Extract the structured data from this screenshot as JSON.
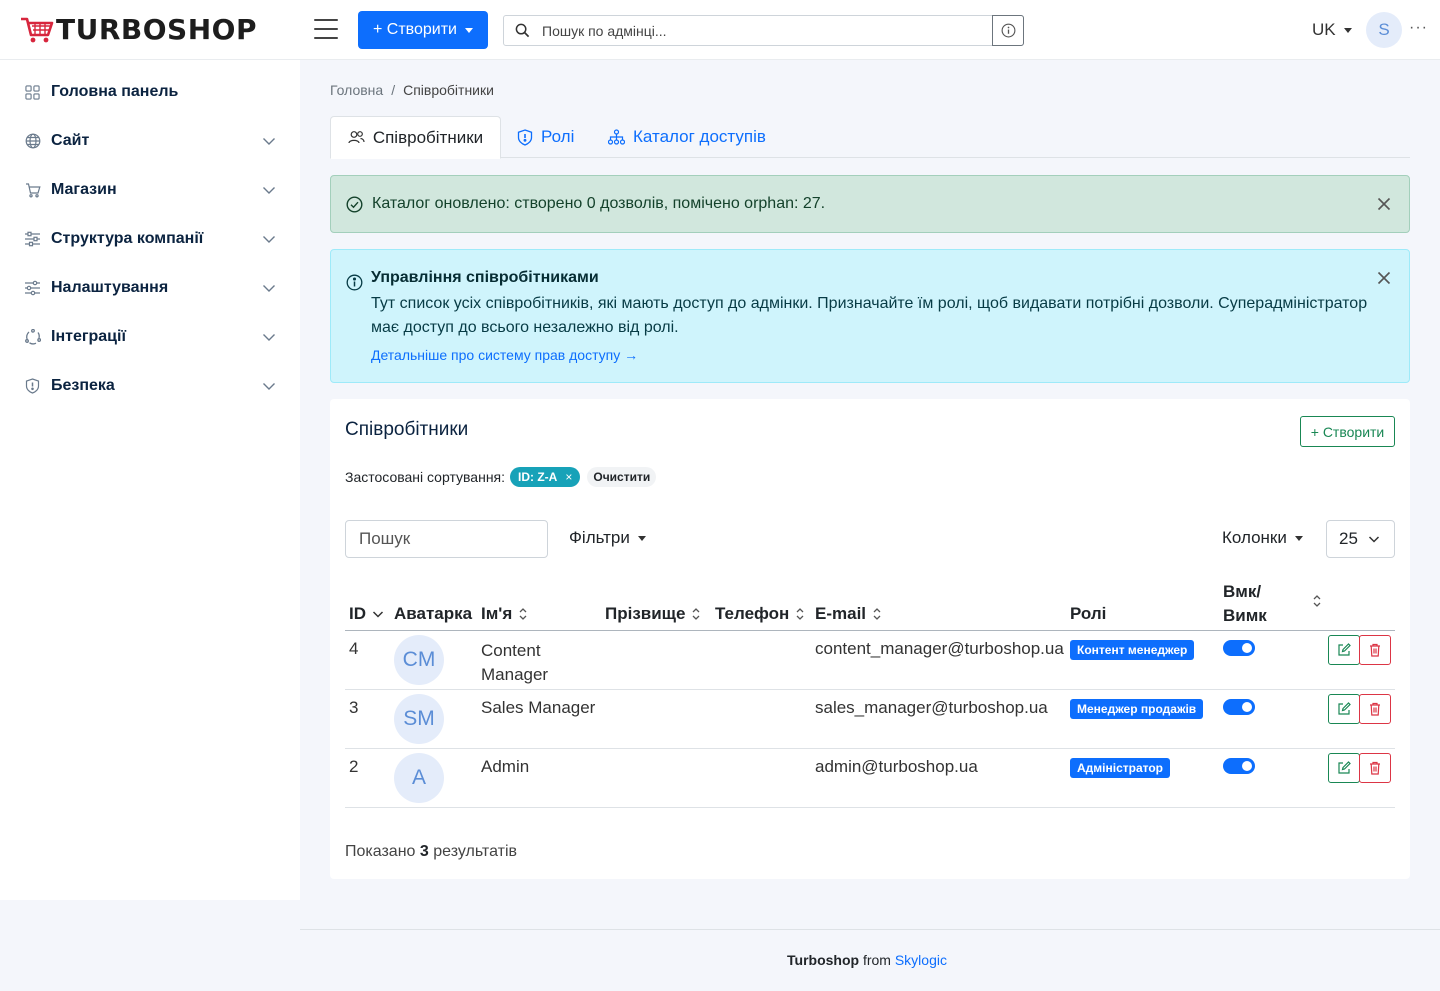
{
  "header": {
    "logo_text": "TURBOSHOP",
    "create_label": "+ Створити",
    "search_placeholder": "Пошук по адмінці...",
    "lang": "UK",
    "user_initial": "S",
    "more": "···"
  },
  "sidebar": {
    "items": [
      {
        "label": "Головна панель",
        "icon": "dashboard-icon"
      },
      {
        "label": "Сайт",
        "icon": "globe-icon"
      },
      {
        "label": "Магазин",
        "icon": "cart-icon"
      },
      {
        "label": "Структура компанії",
        "icon": "sliders-icon"
      },
      {
        "label": "Налаштування",
        "icon": "settings-sliders-icon"
      },
      {
        "label": "Інтеграції",
        "icon": "integrations-icon"
      },
      {
        "label": "Безпека",
        "icon": "shield-icon"
      }
    ]
  },
  "breadcrumb": {
    "home": "Головна",
    "sep": "/",
    "current": "Співробітники"
  },
  "tabs": [
    {
      "label": "Співробітники",
      "active": true
    },
    {
      "label": "Ролі",
      "active": false
    },
    {
      "label": "Каталог доступів",
      "active": false
    }
  ],
  "alert_success": {
    "text": "Каталог оновлено: створено 0 дозволів, помічено orphan: 27."
  },
  "alert_info": {
    "title": "Управління співробітниками",
    "body": "Тут список усіх співробітників, які мають доступ до адмінки. Призначайте їм ролі, щоб видавати потрібні дозволи. Суперадміністратор має доступ до всього незалежно від ролі.",
    "link": "Детальніше про систему прав доступу →"
  },
  "card": {
    "title": "Співробітники",
    "create_label": "+ Створити",
    "sorts_label": "Застосовані сортування:",
    "sort_chip": "ID: Z-A",
    "sort_chip_x": "×",
    "clear_label": "Очистити",
    "search_placeholder": "Пошук",
    "filters_label": "Фільтри",
    "columns_label": "Колонки",
    "per_page": "25",
    "results_prefix": "Показано",
    "results_count": "3",
    "results_suffix": "результатів"
  },
  "table": {
    "headers": {
      "id": "ID",
      "avatar": "Аватарка",
      "first_name": "Ім'я",
      "last_name": "Прізвище",
      "phone": "Телефон",
      "email": "E-mail",
      "roles": "Ролі",
      "active_line1": "Вмк/",
      "active_line2": "Вимк"
    },
    "rows": [
      {
        "id": "4",
        "initials": "CM",
        "name_line1": "Content",
        "name_line2": "Manager",
        "last_name": "",
        "phone": "",
        "email": "content_manager@turboshop.ua",
        "role": "Контент менеджер",
        "active": true
      },
      {
        "id": "3",
        "initials": "SM",
        "name_line1": "Sales Manager",
        "name_line2": "",
        "last_name": "",
        "phone": "",
        "email": "sales_manager@turboshop.ua",
        "role": "Менеджер продажів",
        "active": true
      },
      {
        "id": "2",
        "initials": "A",
        "name_line1": "Admin",
        "name_line2": "",
        "last_name": "",
        "phone": "",
        "email": "admin@turboshop.ua",
        "role": "Адміністратор",
        "active": true
      }
    ]
  },
  "footer": {
    "brand": "Turboshop",
    "from": "from",
    "company": "Skylogic"
  },
  "colors": {
    "primary": "#0d6efd",
    "success": "#198754",
    "danger": "#dc3545",
    "info_chip": "#17a2b8",
    "logo_red": "#d7263d"
  }
}
